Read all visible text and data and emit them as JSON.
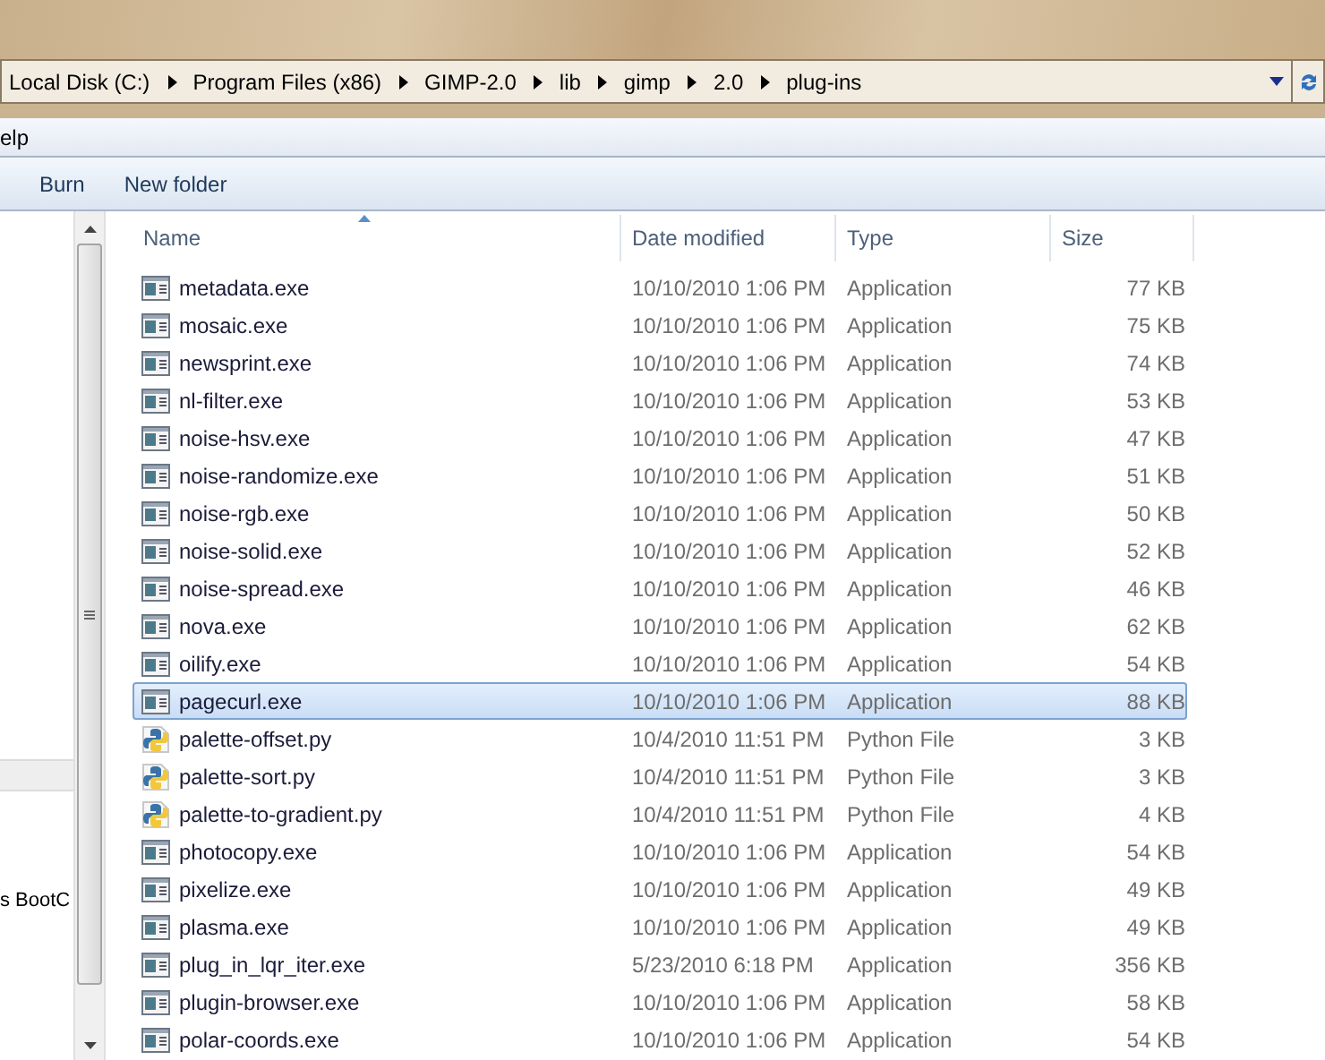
{
  "address": {
    "segments": [
      "Local Disk (C:)",
      "Program Files (x86)",
      "GIMP-2.0",
      "lib",
      "gimp",
      "2.0",
      "plug-ins"
    ]
  },
  "menu": [
    "elp"
  ],
  "toolbar": [
    "Burn",
    "New folder"
  ],
  "nav": {
    "items": [
      "s BootC"
    ]
  },
  "table": {
    "columns": [
      {
        "label": "Name",
        "sorted": true
      },
      {
        "label": "Date modified",
        "sorted": false
      },
      {
        "label": "Type",
        "sorted": false
      },
      {
        "label": "Size",
        "sorted": false
      }
    ],
    "rows": [
      {
        "name": "metadata.exe",
        "date": "10/10/2010 1:06 PM",
        "type": "Application",
        "size": "77 KB",
        "kind": "exe",
        "selected": false
      },
      {
        "name": "mosaic.exe",
        "date": "10/10/2010 1:06 PM",
        "type": "Application",
        "size": "75 KB",
        "kind": "exe",
        "selected": false
      },
      {
        "name": "newsprint.exe",
        "date": "10/10/2010 1:06 PM",
        "type": "Application",
        "size": "74 KB",
        "kind": "exe",
        "selected": false
      },
      {
        "name": "nl-filter.exe",
        "date": "10/10/2010 1:06 PM",
        "type": "Application",
        "size": "53 KB",
        "kind": "exe",
        "selected": false
      },
      {
        "name": "noise-hsv.exe",
        "date": "10/10/2010 1:06 PM",
        "type": "Application",
        "size": "47 KB",
        "kind": "exe",
        "selected": false
      },
      {
        "name": "noise-randomize.exe",
        "date": "10/10/2010 1:06 PM",
        "type": "Application",
        "size": "51 KB",
        "kind": "exe",
        "selected": false
      },
      {
        "name": "noise-rgb.exe",
        "date": "10/10/2010 1:06 PM",
        "type": "Application",
        "size": "50 KB",
        "kind": "exe",
        "selected": false
      },
      {
        "name": "noise-solid.exe",
        "date": "10/10/2010 1:06 PM",
        "type": "Application",
        "size": "52 KB",
        "kind": "exe",
        "selected": false
      },
      {
        "name": "noise-spread.exe",
        "date": "10/10/2010 1:06 PM",
        "type": "Application",
        "size": "46 KB",
        "kind": "exe",
        "selected": false
      },
      {
        "name": "nova.exe",
        "date": "10/10/2010 1:06 PM",
        "type": "Application",
        "size": "62 KB",
        "kind": "exe",
        "selected": false
      },
      {
        "name": "oilify.exe",
        "date": "10/10/2010 1:06 PM",
        "type": "Application",
        "size": "54 KB",
        "kind": "exe",
        "selected": false
      },
      {
        "name": "pagecurl.exe",
        "date": "10/10/2010 1:06 PM",
        "type": "Application",
        "size": "88 KB",
        "kind": "exe",
        "selected": true
      },
      {
        "name": "palette-offset.py",
        "date": "10/4/2010 11:51 PM",
        "type": "Python File",
        "size": "3 KB",
        "kind": "py",
        "selected": false
      },
      {
        "name": "palette-sort.py",
        "date": "10/4/2010 11:51 PM",
        "type": "Python File",
        "size": "3 KB",
        "kind": "py",
        "selected": false
      },
      {
        "name": "palette-to-gradient.py",
        "date": "10/4/2010 11:51 PM",
        "type": "Python File",
        "size": "4 KB",
        "kind": "py",
        "selected": false
      },
      {
        "name": "photocopy.exe",
        "date": "10/10/2010 1:06 PM",
        "type": "Application",
        "size": "54 KB",
        "kind": "exe",
        "selected": false
      },
      {
        "name": "pixelize.exe",
        "date": "10/10/2010 1:06 PM",
        "type": "Application",
        "size": "49 KB",
        "kind": "exe",
        "selected": false
      },
      {
        "name": "plasma.exe",
        "date": "10/10/2010 1:06 PM",
        "type": "Application",
        "size": "49 KB",
        "kind": "exe",
        "selected": false
      },
      {
        "name": "plug_in_lqr_iter.exe",
        "date": "5/23/2010 6:18 PM",
        "type": "Application",
        "size": "356 KB",
        "kind": "exe",
        "selected": false
      },
      {
        "name": "plugin-browser.exe",
        "date": "10/10/2010 1:06 PM",
        "type": "Application",
        "size": "58 KB",
        "kind": "exe",
        "selected": false
      },
      {
        "name": "polar-coords.exe",
        "date": "10/10/2010 1:06 PM",
        "type": "Application",
        "size": "54 KB",
        "kind": "exe",
        "selected": false
      }
    ]
  }
}
